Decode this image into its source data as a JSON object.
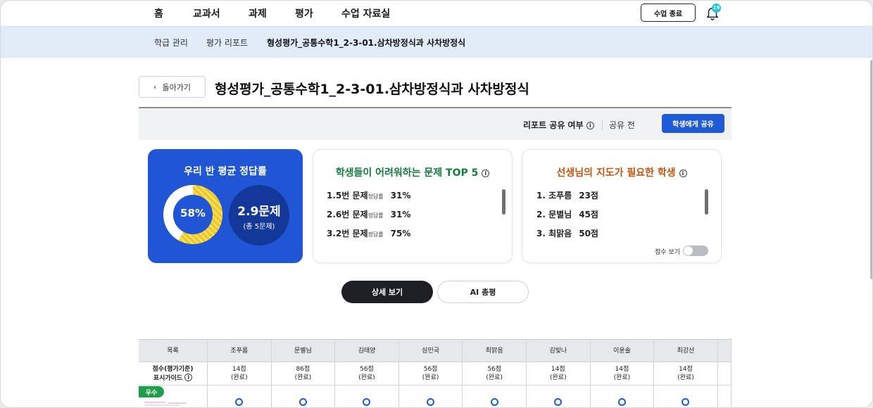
{
  "nav": {
    "home": "홈",
    "textbook": "교과서",
    "assignment": "과제",
    "evaluation": "평가",
    "materials": "수업 자료실",
    "end_class": "수업 종료",
    "notification_count": "19"
  },
  "subnav": {
    "class_manage": "학급 관리",
    "eval_report": "평가 리포트",
    "current": "형성평가_공통수학1_2-3-01.삼차방정식과 사차방정식"
  },
  "page": {
    "back_label": "돌아가기",
    "title": "형성평가_공통수학1_2-3-01.삼차방정식과 사차방정식"
  },
  "share": {
    "label": "리포트 공유 여부",
    "status": "공유 전",
    "button": "학생에게 공유"
  },
  "avg_card": {
    "title": "우리 반 평균 정답률",
    "percent_label": "58%",
    "percent_value": 58,
    "count_main": "2.9문제",
    "count_sub": "(총 5문제)"
  },
  "difficult_card": {
    "title": "학생들이 어려워하는 문제 TOP 5",
    "correct_label": "정답률",
    "items": [
      {
        "name": "1.5번 문제",
        "pct": "31%"
      },
      {
        "name": "2.6번 문제",
        "pct": "31%"
      },
      {
        "name": "3.2번 문제",
        "pct": "75%"
      }
    ]
  },
  "guidance_card": {
    "title": "선생님의 지도가 필요한 학생",
    "items": [
      {
        "rank": "1. 조푸름",
        "score": "23점"
      },
      {
        "rank": "2. 문별님",
        "score": "45점"
      },
      {
        "rank": "3. 최맑음",
        "score": "50점"
      }
    ],
    "toggle_label": "점수 보기"
  },
  "tabs": {
    "detail": "상세 보기",
    "ai": "AI 총평"
  },
  "table": {
    "header_label": "목록",
    "score_label_line1": "점수(평가기준)",
    "score_label_line2": "표시가이드",
    "grade_badge": "우수",
    "students": [
      {
        "name": "조푸름",
        "score": "14점",
        "status": "(완료)"
      },
      {
        "name": "문별님",
        "score": "86점",
        "status": "(완료)"
      },
      {
        "name": "김태양",
        "score": "56점",
        "status": "(완료)"
      },
      {
        "name": "심민국",
        "score": "56점",
        "status": "(완료)"
      },
      {
        "name": "최맑음",
        "score": "56점",
        "status": "(완료)"
      },
      {
        "name": "김빛나",
        "score": "14점",
        "status": "(완료)"
      },
      {
        "name": "이윤솔",
        "score": "14점",
        "status": "(완료)"
      },
      {
        "name": "최강산",
        "score": "14점",
        "status": "(완료)"
      }
    ]
  },
  "colors": {
    "primary": "#1f5bd7",
    "avg_card_bg": "#2056d5",
    "donut_fill": "#f2c81d",
    "difficult_title": "#177a3f",
    "guidance_title": "#c4530e",
    "grade_badge": "#1f9d4a"
  }
}
